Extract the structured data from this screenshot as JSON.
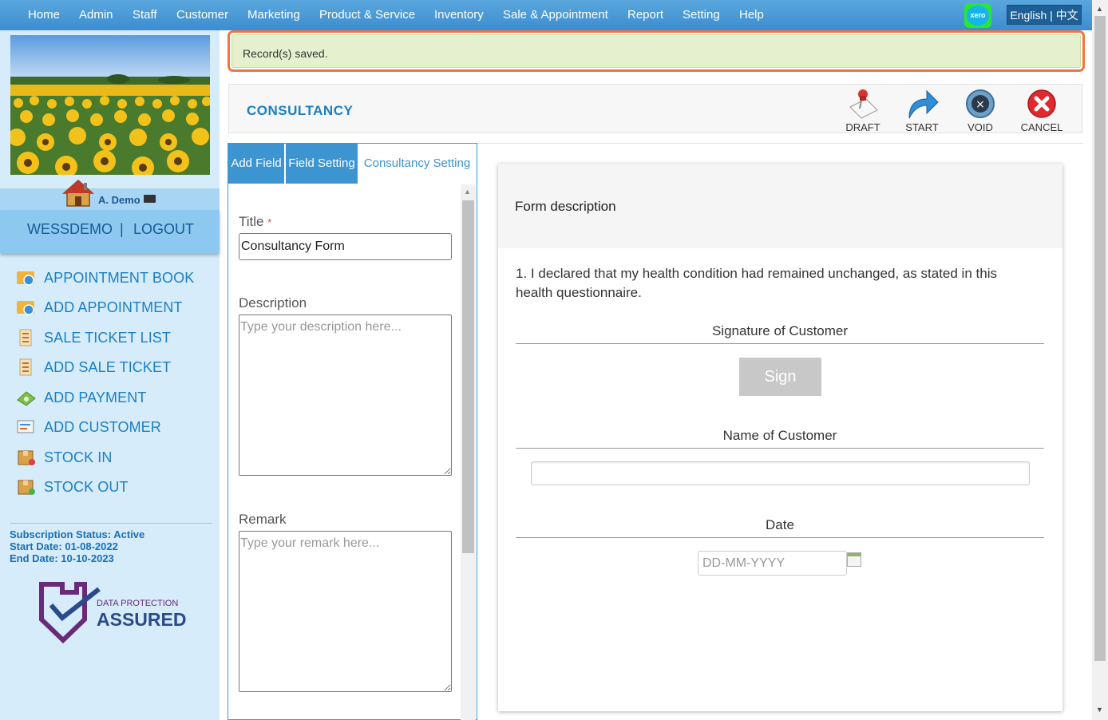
{
  "nav": {
    "items": [
      "Home",
      "Admin",
      "Staff",
      "Customer",
      "Marketing",
      "Product & Service",
      "Inventory",
      "Sale & Appointment",
      "Report",
      "Setting",
      "Help"
    ],
    "xero_label": "xero",
    "language": "English | 中文"
  },
  "sidebar": {
    "user_name": "A. Demo",
    "account": "WESSDEMO",
    "separator": "|",
    "logout": "LOGOUT",
    "menu": [
      {
        "label": "APPOINTMENT BOOK",
        "icon": "appointment-book-icon"
      },
      {
        "label": "ADD APPOINTMENT",
        "icon": "add-appointment-icon"
      },
      {
        "label": "SALE TICKET LIST",
        "icon": "sale-ticket-list-icon"
      },
      {
        "label": "ADD SALE TICKET",
        "icon": "add-sale-ticket-icon"
      },
      {
        "label": "ADD PAYMENT",
        "icon": "add-payment-icon"
      },
      {
        "label": "ADD CUSTOMER",
        "icon": "add-customer-icon"
      },
      {
        "label": "STOCK IN",
        "icon": "stock-in-icon"
      },
      {
        "label": "STOCK OUT",
        "icon": "stock-out-icon"
      }
    ],
    "subscription": {
      "status": "Subscription Status: Active",
      "start": "Start Date: 01-08-2022",
      "end": "End Date: 10-10-2023"
    },
    "badge": {
      "line1": "DATA PROTECTION",
      "line2": "ASSURED"
    }
  },
  "alert": {
    "message": "Record(s) saved."
  },
  "page": {
    "title": "CONSULTANCY",
    "toolbar": {
      "draft": "DRAFT",
      "start": "START",
      "void": "VOID",
      "cancel": "CANCEL"
    }
  },
  "editor": {
    "tabs": [
      "Add Field",
      "Field Setting",
      "Consultancy Setting"
    ],
    "title_label": "Title",
    "required_mark": "*",
    "title_value": "Consultancy Form",
    "description_label": "Description",
    "description_placeholder": "Type your description here...",
    "remark_label": "Remark",
    "remark_placeholder": "Type your remark here..."
  },
  "preview": {
    "form_description": "Form description",
    "question_number": "1.",
    "question": "I declared that my health condition had remained unchanged, as stated in this health questionnaire.",
    "signature_label": "Signature of Customer",
    "sign_button": "Sign",
    "name_label": "Name of Customer",
    "date_label": "Date",
    "date_placeholder": "DD-MM-YYYY"
  },
  "colors": {
    "nav": "#3c8dd0",
    "accent": "#1a7fc4",
    "alert_border": "#f4753b",
    "alert_bg": "#e5f1ce",
    "sidebar_bg": "#d6ecfb",
    "cancel_red": "#e0292f"
  }
}
